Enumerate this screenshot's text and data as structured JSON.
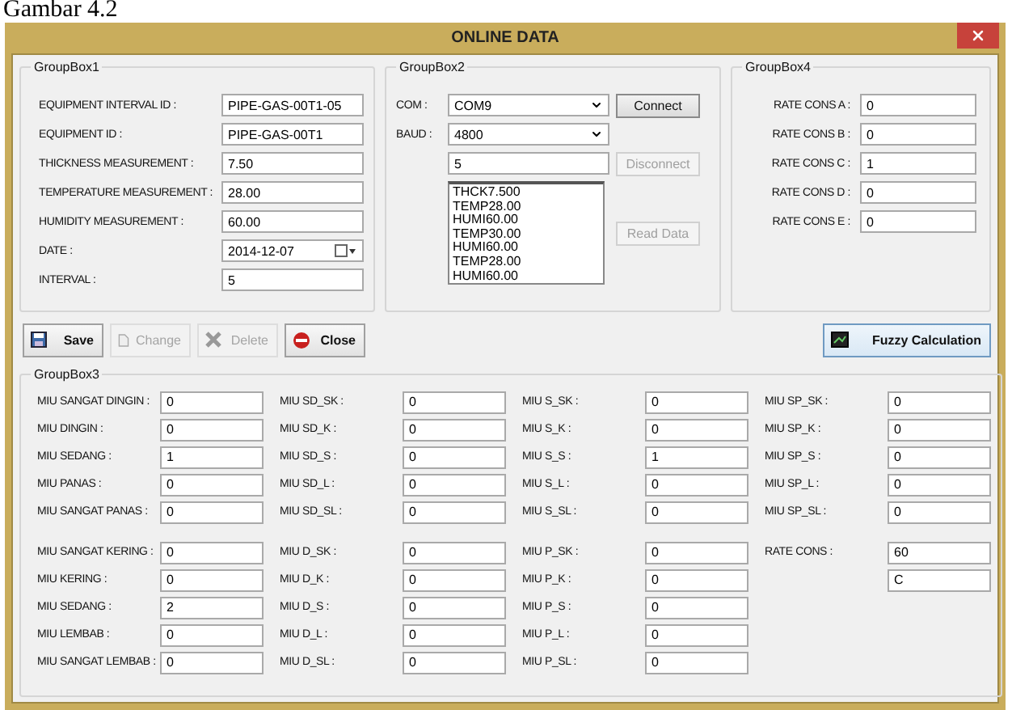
{
  "caption": "Gambar 4.2",
  "window": {
    "title": "ONLINE DATA"
  },
  "groupbox1": {
    "title": "GroupBox1",
    "fields": [
      {
        "kind": "text",
        "label": "EQUIPMENT INTERVAL ID :",
        "value": "PIPE-GAS-00T1-05"
      },
      {
        "kind": "text",
        "label": "EQUIPMENT ID :",
        "value": "PIPE-GAS-00T1"
      },
      {
        "kind": "text",
        "label": "THICKNESS MEASUREMENT :",
        "value": "7.50"
      },
      {
        "kind": "text",
        "label": "TEMPERATURE MEASUREMENT :",
        "value": "28.00"
      },
      {
        "kind": "text",
        "label": "HUMIDITY MEASUREMENT :",
        "value": "60.00"
      },
      {
        "kind": "date",
        "label": "DATE :",
        "value": "2014-12-07"
      },
      {
        "kind": "text",
        "label": "INTERVAL :",
        "value": "5"
      }
    ]
  },
  "groupbox2": {
    "title": "GroupBox2",
    "com": {
      "label": "COM :",
      "value": "COM9"
    },
    "baud": {
      "label": "BAUD :",
      "value": "4800"
    },
    "input": "5",
    "log": [
      "THCK7.500",
      "TEMP28.00",
      "HUMI60.00",
      "TEMP30.00",
      "HUMI60.00",
      "TEMP28.00",
      "HUMI60.00"
    ],
    "buttons": [
      {
        "label": "Connect",
        "disabled": false
      },
      {
        "label": "Disconnect",
        "disabled": true
      },
      {
        "label": "Read Data",
        "disabled": true
      }
    ]
  },
  "groupbox4": {
    "title": "GroupBox4",
    "fields": [
      {
        "label": "RATE CONS A :",
        "value": "0"
      },
      {
        "label": "RATE CONS B :",
        "value": "0"
      },
      {
        "label": "RATE CONS C :",
        "value": "1"
      },
      {
        "label": "RATE CONS D :",
        "value": "0"
      },
      {
        "label": "RATE CONS E :",
        "value": "0"
      }
    ]
  },
  "toolbar": [
    {
      "kind": "save",
      "label": "Save",
      "disabled": false
    },
    {
      "kind": "change",
      "label": "Change",
      "disabled": true
    },
    {
      "kind": "delete",
      "label": "Delete",
      "disabled": true
    },
    {
      "kind": "close",
      "label": "Close",
      "disabled": false
    }
  ],
  "fuzzy_button": {
    "label": "Fuzzy Calculation"
  },
  "groupbox3": {
    "title": "GroupBox3",
    "columns": [
      {
        "groups": [
          [
            {
              "label": "MIU SANGAT DINGIN :",
              "value": "0"
            },
            {
              "label": "MIU DINGIN :",
              "value": "0"
            },
            {
              "label": "MIU SEDANG :",
              "value": "1"
            },
            {
              "label": "MIU PANAS :",
              "value": "0"
            },
            {
              "label": "MIU SANGAT PANAS :",
              "value": "0"
            }
          ],
          [
            {
              "label": "MIU SANGAT KERING :",
              "value": "0"
            },
            {
              "label": "MIU KERING :",
              "value": "0"
            },
            {
              "label": "MIU SEDANG :",
              "value": "2"
            },
            {
              "label": "MIU LEMBAB :",
              "value": "0"
            },
            {
              "label": "MIU SANGAT LEMBAB :",
              "value": "0"
            }
          ]
        ]
      },
      {
        "groups": [
          [
            {
              "label": "MIU SD_SK :",
              "value": "0"
            },
            {
              "label": "MIU SD_K :",
              "value": "0"
            },
            {
              "label": "MIU SD_S :",
              "value": "0"
            },
            {
              "label": "MIU SD_L :",
              "value": "0"
            },
            {
              "label": "MIU SD_SL :",
              "value": "0"
            }
          ],
          [
            {
              "label": "MIU D_SK :",
              "value": "0"
            },
            {
              "label": "MIU D_K :",
              "value": "0"
            },
            {
              "label": "MIU D_S :",
              "value": "0"
            },
            {
              "label": "MIU D_L :",
              "value": "0"
            },
            {
              "label": "MIU D_SL :",
              "value": "0"
            }
          ]
        ]
      },
      {
        "groups": [
          [
            {
              "label": "MIU S_SK :",
              "value": "0"
            },
            {
              "label": "MIU S_K :",
              "value": "0"
            },
            {
              "label": "MIU S_S :",
              "value": "1"
            },
            {
              "label": "MIU S_L :",
              "value": "0"
            },
            {
              "label": "MIU S_SL :",
              "value": "0"
            }
          ],
          [
            {
              "label": "MIU P_SK :",
              "value": "0"
            },
            {
              "label": "MIU P_K :",
              "value": "0"
            },
            {
              "label": "MIU P_S :",
              "value": "0"
            },
            {
              "label": "MIU P_L :",
              "value": "0"
            },
            {
              "label": "MIU P_SL :",
              "value": "0"
            }
          ]
        ]
      },
      {
        "groups": [
          [
            {
              "label": "MIU SP_SK :",
              "value": "0"
            },
            {
              "label": "MIU SP_K :",
              "value": "0"
            },
            {
              "label": "MIU SP_S :",
              "value": "0"
            },
            {
              "label": "MIU SP_L :",
              "value": "0"
            },
            {
              "label": "MIU SP_SL :",
              "value": "0"
            }
          ],
          [
            {
              "label": "RATE CONS :",
              "value": "60"
            },
            {
              "value": "C"
            }
          ]
        ]
      }
    ]
  }
}
